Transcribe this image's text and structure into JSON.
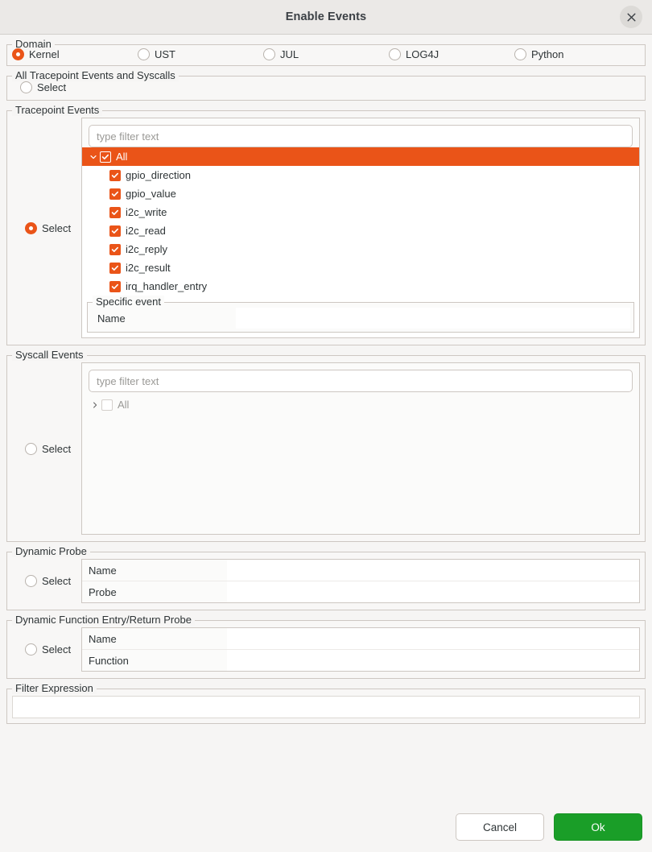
{
  "window": {
    "title": "Enable Events",
    "close_icon": "close-icon"
  },
  "domain": {
    "legend": "Domain",
    "options": [
      {
        "label": "Kernel",
        "selected": true
      },
      {
        "label": "UST",
        "selected": false
      },
      {
        "label": "JUL",
        "selected": false
      },
      {
        "label": "LOG4J",
        "selected": false
      },
      {
        "label": "Python",
        "selected": false
      }
    ]
  },
  "all_events": {
    "legend": "All Tracepoint Events and Syscalls",
    "select_label": "Select",
    "selected": false
  },
  "tracepoint_events": {
    "legend": "Tracepoint Events",
    "select_label": "Select",
    "selected": true,
    "filter_placeholder": "type filter text",
    "filter_value": "",
    "tree": {
      "root": {
        "label": "All",
        "checked": true,
        "expanded": true,
        "highlighted": true
      },
      "children": [
        {
          "label": "gpio_direction",
          "checked": true
        },
        {
          "label": "gpio_value",
          "checked": true
        },
        {
          "label": "i2c_write",
          "checked": true
        },
        {
          "label": "i2c_read",
          "checked": true
        },
        {
          "label": "i2c_reply",
          "checked": true
        },
        {
          "label": "i2c_result",
          "checked": true
        },
        {
          "label": "irq_handler_entry",
          "checked": true
        }
      ]
    },
    "specific_event": {
      "legend": "Specific event",
      "name_label": "Name",
      "name_value": ""
    }
  },
  "syscall_events": {
    "legend": "Syscall Events",
    "select_label": "Select",
    "selected": false,
    "filter_placeholder": "type filter text",
    "filter_value": "",
    "tree": {
      "root": {
        "label": "All",
        "checked": false,
        "expanded": false,
        "disabled": true
      }
    }
  },
  "dynamic_probe": {
    "legend": "Dynamic Probe",
    "select_label": "Select",
    "selected": false,
    "fields": [
      {
        "label": "Name",
        "value": ""
      },
      {
        "label": "Probe",
        "value": ""
      }
    ]
  },
  "dynamic_function_probe": {
    "legend": "Dynamic Function Entry/Return Probe",
    "select_label": "Select",
    "selected": false,
    "fields": [
      {
        "label": "Name",
        "value": ""
      },
      {
        "label": "Function",
        "value": ""
      }
    ]
  },
  "filter_expression": {
    "legend": "Filter Expression",
    "value": "",
    "placeholder": ""
  },
  "footer": {
    "cancel_label": "Cancel",
    "ok_label": "Ok"
  },
  "colors": {
    "accent": "#ea5418",
    "ok_button": "#1a9e28",
    "window_bg": "#f6f5f4",
    "titlebar_bg": "#ebe9e7",
    "border": "#cdc7c2"
  }
}
